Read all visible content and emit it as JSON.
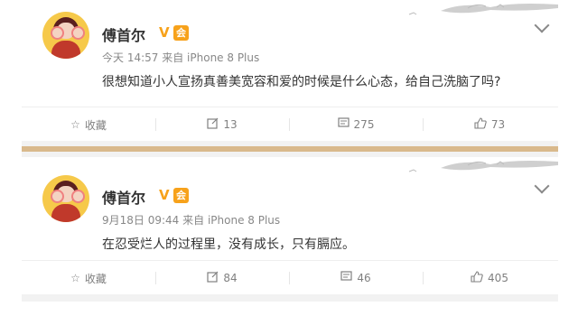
{
  "posts": [
    {
      "author": "傅首尔",
      "verified_mark": "V",
      "badge_text": "会",
      "time": "今天 14:57",
      "source": "来自 iPhone 8 Plus",
      "content": "很想知道小人宣扬真善美宽容和爱的时候是什么心态，给自己洗脑了吗?",
      "actions": {
        "favorite": "收藏",
        "repost": "13",
        "comment": "275",
        "like": "73"
      }
    },
    {
      "author": "傅首尔",
      "verified_mark": "V",
      "badge_text": "会",
      "time": "9月18日 09:44",
      "source": "来自 iPhone 8 Plus",
      "content": "在忍受烂人的过程里，没有成长，只有膈应。",
      "actions": {
        "favorite": "收藏",
        "repost": "84",
        "comment": "46",
        "like": "405"
      }
    }
  ],
  "icons": {
    "favorite": "star-icon",
    "repost": "share-icon",
    "comment": "comment-icon",
    "like": "thumbs-up-icon",
    "menu": "chevron-down-icon"
  },
  "colors": {
    "accent": "#f7a21b",
    "divider": "#d9b98c",
    "muted": "#888888"
  }
}
